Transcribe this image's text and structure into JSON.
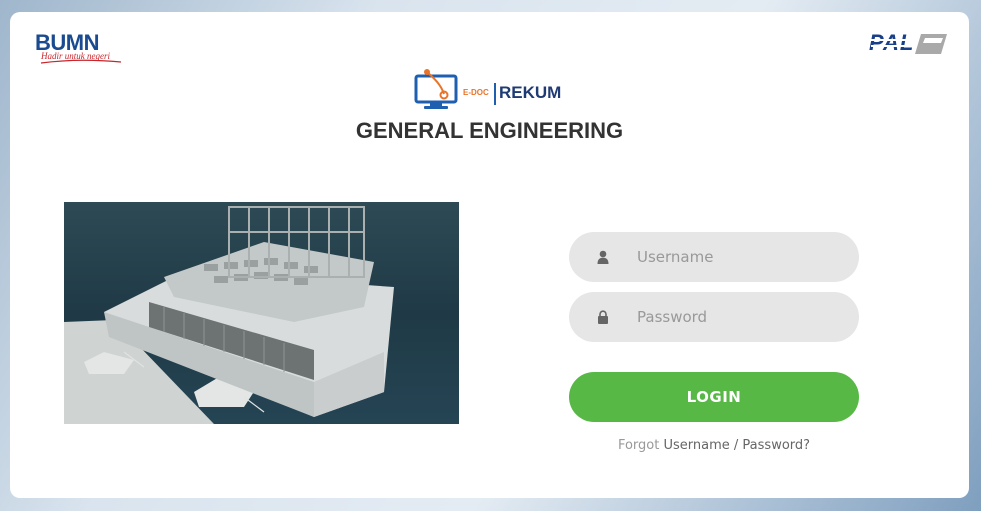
{
  "brand": {
    "bumn": {
      "word": "BUMN",
      "tagline": "Hadir untuk negeri"
    },
    "pal": {
      "word": "PAL"
    },
    "app_logo": {
      "prefix": "E-DOC",
      "name": "REKUM"
    }
  },
  "page": {
    "title": "GENERAL ENGINEERING"
  },
  "form": {
    "username": {
      "placeholder": "Username",
      "value": "",
      "icon": "user-icon"
    },
    "password": {
      "placeholder": "Password",
      "value": "",
      "icon": "lock-icon"
    },
    "login_label": "LOGIN",
    "forgot": {
      "prefix": "Forgot",
      "username_link": "Username",
      "separator": "/",
      "password_link": "Password?"
    }
  },
  "colors": {
    "login_button": "#57b846",
    "input_background": "#e6e6e6",
    "title": "#333333",
    "bumn_blue": "#1a4a8f",
    "edoc_orange": "#e8742a"
  }
}
